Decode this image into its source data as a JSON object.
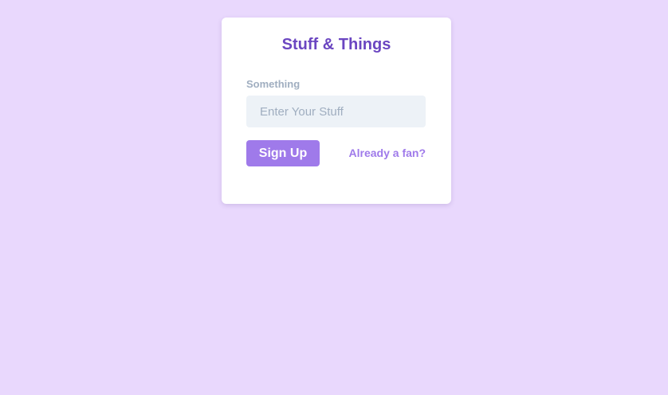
{
  "form": {
    "title": "Stuff & Things",
    "field_label": "Something",
    "input_placeholder": "Enter Your Stuff",
    "input_value": "",
    "submit_label": "Sign Up",
    "link_label": "Already a fan?"
  },
  "colors": {
    "background": "#e9d8fd",
    "card": "#ffffff",
    "accent": "#9f7aea",
    "title": "#6b46c1",
    "input_bg": "#edf2f7",
    "muted": "#a0aec0"
  }
}
